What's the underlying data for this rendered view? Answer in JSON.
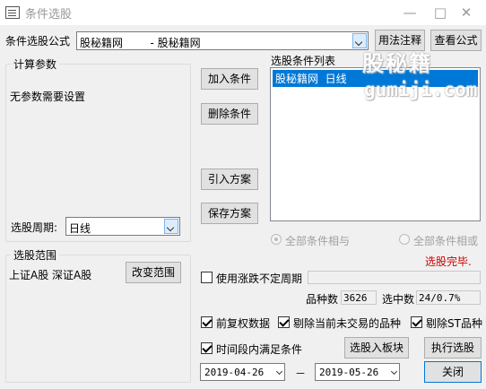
{
  "window": {
    "title": "条件选股",
    "min_icon": "—",
    "max_icon": "□",
    "close_icon": "✕"
  },
  "formula": {
    "label": "条件选股公式",
    "value": "股秘籍网        - 股秘籍网",
    "usage_button": "用法注释",
    "view_button": "查看公式"
  },
  "params": {
    "group_title": "计算参数",
    "empty_text": "无参数需要设置",
    "period_label": "选股周期:",
    "period_value": "日线"
  },
  "buttons": {
    "add": "加入条件",
    "delete": "删除条件",
    "import": "引入方案",
    "save": "保存方案"
  },
  "conditions": {
    "title": "选股条件列表",
    "items": [
      "股秘籍网  日线"
    ]
  },
  "logic": {
    "all_and": "全部条件相与",
    "all_or": "全部条件相或"
  },
  "status": {
    "text": "选股完毕.",
    "color": "#cc0000"
  },
  "scope": {
    "group_title": "选股范围",
    "value": "上证A股 深证A股",
    "change_button": "改变范围"
  },
  "variable_period": {
    "label": "使用涨跌不定周期",
    "checked": false
  },
  "counts": {
    "total_label": "品种数",
    "total_value": "3626",
    "selected_label": "选中数",
    "selected_value": "24/0.7%"
  },
  "options": {
    "pre_adjust": {
      "label": "前复权数据",
      "checked": true
    },
    "exclude_untraded": {
      "label": "剔除当前未交易的品种",
      "checked": true
    },
    "exclude_st": {
      "label": "剔除ST品种",
      "checked": true
    },
    "time_range": {
      "label": "时间段内满足条件",
      "checked": true
    }
  },
  "actions": {
    "to_block": "选股入板块",
    "run": "执行选股",
    "close": "关闭"
  },
  "dates": {
    "start": "2019-04-26",
    "separator": "－",
    "end": "2019-05-26"
  },
  "watermark": {
    "line1": "股秘籍",
    "line2": "gumiji.com"
  }
}
